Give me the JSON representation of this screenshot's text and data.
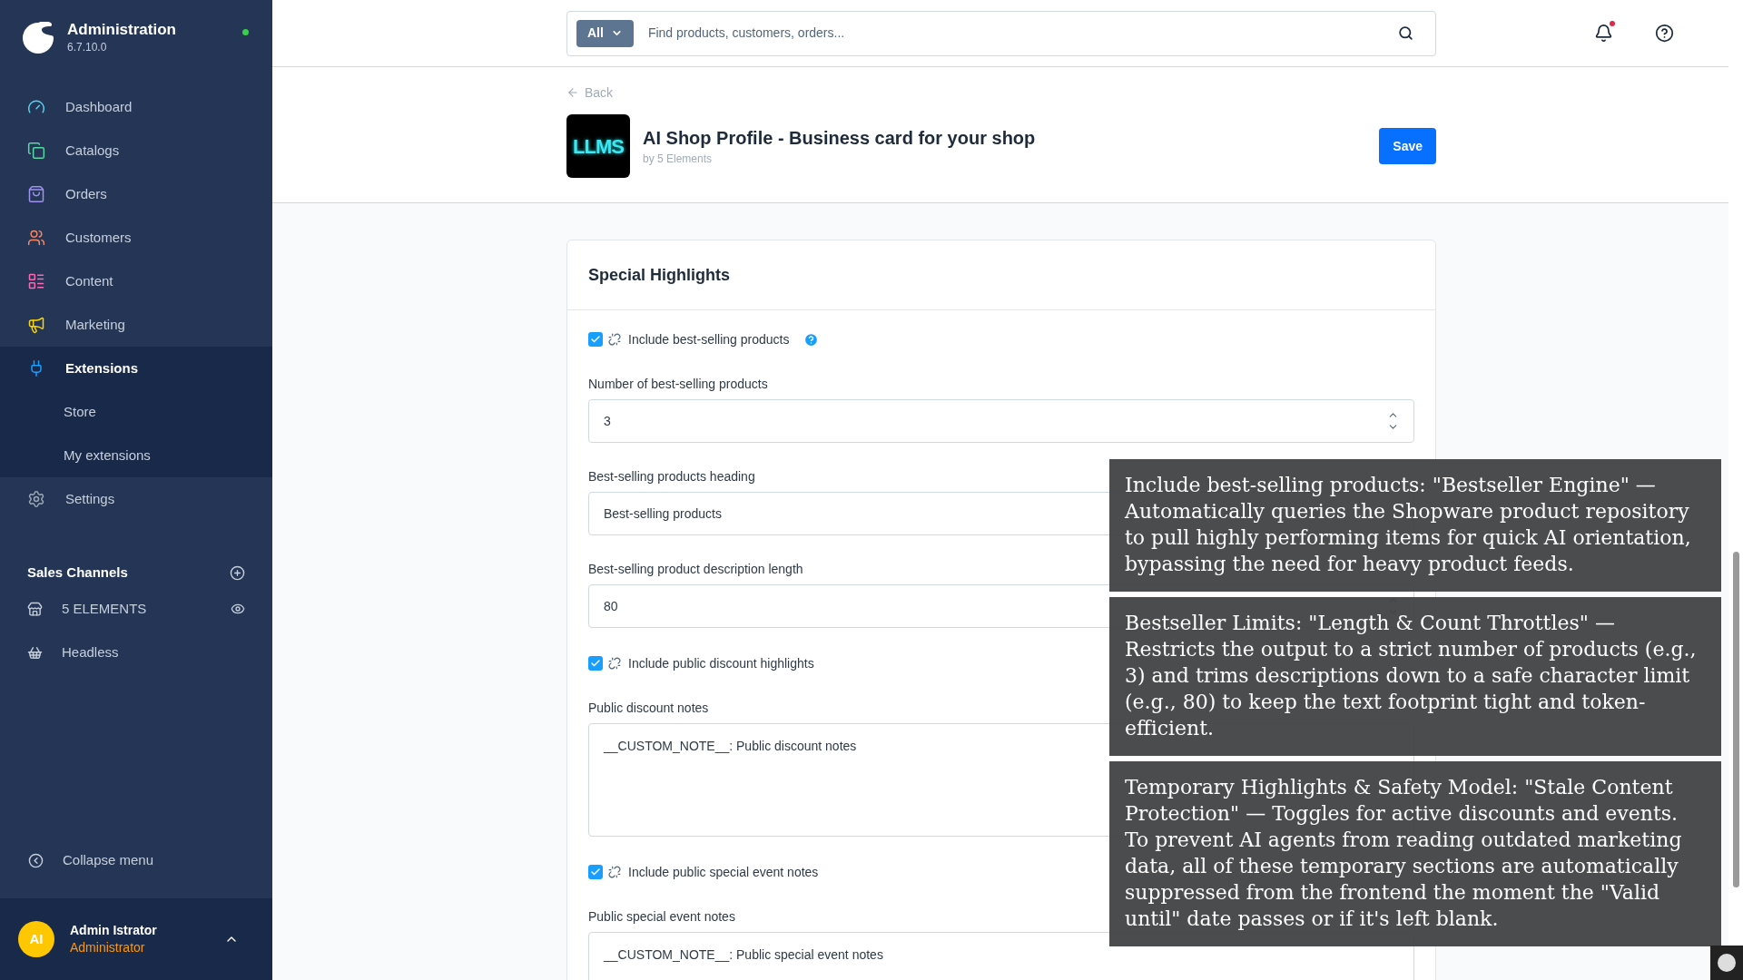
{
  "sidebar": {
    "brand": {
      "title": "Administration",
      "version": "6.7.10.0",
      "online": true
    },
    "nav": [
      {
        "label": "Dashboard",
        "kind": "dashboard",
        "color": "#5ad2f0",
        "selected": false
      },
      {
        "label": "Catalogs",
        "kind": "catalogs",
        "color": "#57d9a3",
        "selected": false
      },
      {
        "label": "Orders",
        "kind": "orders",
        "color": "#a092f0",
        "selected": false
      },
      {
        "label": "Customers",
        "kind": "customers",
        "color": "#f88962",
        "selected": false
      },
      {
        "label": "Content",
        "kind": "content",
        "color": "#ff68b4",
        "selected": false
      },
      {
        "label": "Marketing",
        "kind": "marketing",
        "color": "#ffd700",
        "selected": false
      },
      {
        "label": "Extensions",
        "kind": "extensions",
        "color": "#189eff",
        "selected": true,
        "children": [
          {
            "label": "Store",
            "selected": false
          },
          {
            "label": "My extensions",
            "selected": false
          }
        ]
      },
      {
        "label": "Settings",
        "kind": "settings",
        "color": "#9aa8b5",
        "selected": false
      }
    ],
    "sales_channels": {
      "title": "Sales Channels",
      "items": [
        {
          "label": "5 ELEMENTS",
          "kind": "storefront",
          "preview": true
        },
        {
          "label": "Headless",
          "kind": "headless",
          "preview": false
        }
      ]
    },
    "collapse": "Collapse menu",
    "user": {
      "initials": "AI",
      "name": "Admin Istrator",
      "role": "Administrator"
    }
  },
  "topbar": {
    "search": {
      "scope": "All",
      "placeholder": "Find products, customers, orders..."
    },
    "notifications": {
      "unread": true
    }
  },
  "header": {
    "back": "Back",
    "logo_text": "LLMS",
    "title": "AI Shop Profile - Business card for your shop",
    "author": "by 5 Elements",
    "save": "Save"
  },
  "card": {
    "title": "Special Highlights",
    "fields": [
      {
        "kind": "checkbox",
        "label": "Include best-selling products",
        "checked": true,
        "help": true
      },
      {
        "kind": "number",
        "label": "Number of best-selling products",
        "value": "3"
      },
      {
        "kind": "text",
        "label": "Best-selling products heading",
        "value": "Best-selling products"
      },
      {
        "kind": "number",
        "label": "Best-selling product description length",
        "value": "80"
      },
      {
        "kind": "checkbox",
        "label": "Include public discount highlights",
        "checked": true,
        "help": false
      },
      {
        "kind": "textarea",
        "label": "Public discount notes",
        "value": "__CUSTOM_NOTE__: Public discount notes"
      },
      {
        "kind": "checkbox",
        "label": "Include public special event notes",
        "checked": true,
        "help": false
      },
      {
        "kind": "textarea",
        "label": "Public special event notes",
        "value": "__CUSTOM_NOTE__: Public special event notes"
      }
    ]
  },
  "annotations": [
    "Include best-selling products: \"Bestseller Engine\" — Automatically queries the Shopware product repository to pull highly performing items for quick AI orientation, bypassing the need for heavy product feeds.",
    "Bestseller Limits: \"Length & Count Throttles\" — Restricts the output to a strict number of products (e.g., 3) and trims descriptions down to a safe character limit (e.g., 80) to keep the text footprint tight and token-efficient.",
    "Temporary Highlights & Safety Model: \"Stale Content Protection\" — Toggles for active discounts and events. To prevent AI agents from reading outdated marketing data, all of these temporary sections are automatically suppressed from the frontend the moment the \"Valid until\" date passes or if it's left blank."
  ]
}
